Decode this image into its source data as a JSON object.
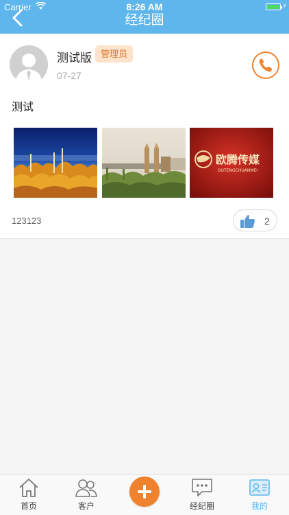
{
  "status_bar": {
    "carrier": "Carrier",
    "time": "8:26 AM"
  },
  "header": {
    "title": "经纪圈"
  },
  "post": {
    "username": "测试版",
    "badge": "管理员",
    "date": "07-27",
    "content": "测试",
    "caption": "123123",
    "like_count": "2",
    "photo_brand_text": "欧腾传媒",
    "photo_brand_sub": "OUTENGCHUANMEI"
  },
  "tabs": [
    {
      "label": "首页",
      "icon": "home-icon"
    },
    {
      "label": "客户",
      "icon": "customers-icon"
    },
    {
      "label": "经纪圈",
      "icon": "chat-icon"
    },
    {
      "label": "我的",
      "icon": "profile-card-icon"
    }
  ],
  "colors": {
    "header": "#5eb6ec",
    "accent_orange": "#f0812d",
    "active_tab": "#5eb6ec",
    "badge_bg": "#fde3cc"
  }
}
